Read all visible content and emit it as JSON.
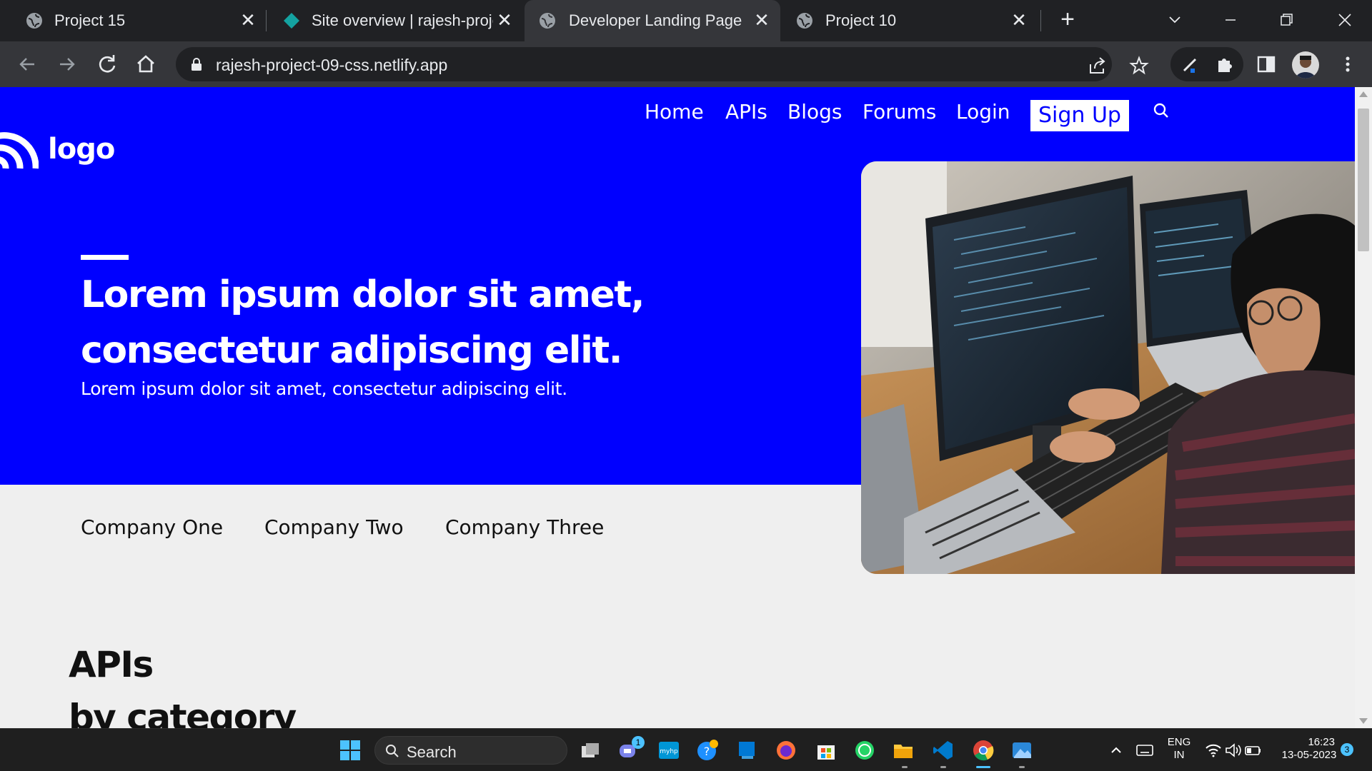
{
  "browser": {
    "tabs": [
      {
        "title": "Project 15",
        "favicon": "globe-icon",
        "active": false
      },
      {
        "title": "Site overview | rajesh-proje",
        "favicon": "netlify-icon",
        "active": false
      },
      {
        "title": "Developer Landing Page",
        "favicon": "globe-icon",
        "active": true
      },
      {
        "title": "Project 10",
        "favicon": "globe-icon",
        "active": false
      }
    ],
    "url": "rajesh-project-09-css.netlify.app"
  },
  "page": {
    "logo_text": "logo",
    "nav": {
      "home": "Home",
      "apis": "APIs",
      "blogs": "Blogs",
      "forums": "Forums",
      "login": "Login",
      "signup": "Sign Up"
    },
    "hero": {
      "headline_line1": "Lorem ipsum dolor sit amet,",
      "headline_line2": "consectetur adipiscing elit.",
      "subline": "Lorem ipsum dolor sit amet, consectetur adipiscing elit."
    },
    "companies": [
      "Company One",
      "Company Two",
      "Company Three"
    ],
    "apis_section": {
      "title": "APIs",
      "subtitle": "by category"
    },
    "colors": {
      "hero_blue": "#0000ff",
      "page_bg": "#efefef"
    }
  },
  "taskbar": {
    "search_label": "Search",
    "lang_top": "ENG",
    "lang_bottom": "IN",
    "time": "16:23",
    "date": "13-05-2023",
    "notification_count": "3",
    "teams_badge": "1"
  }
}
